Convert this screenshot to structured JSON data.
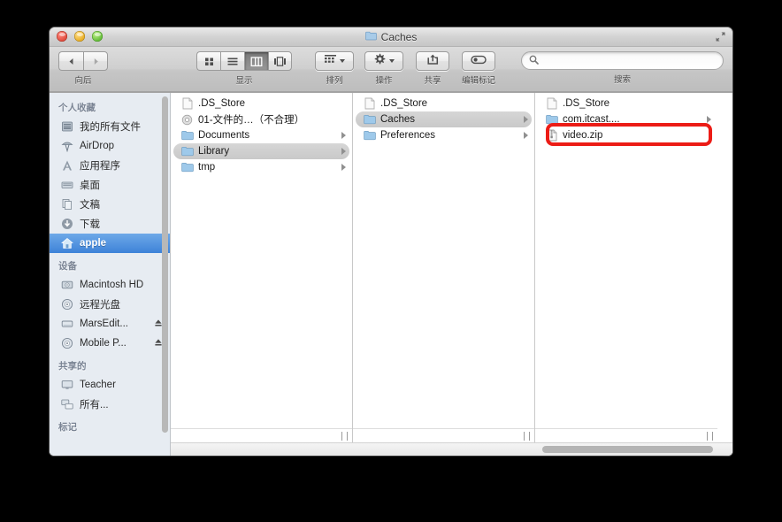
{
  "window": {
    "title": "Caches",
    "title_icon": "folder-icon",
    "traffic_lights": [
      "close-button",
      "minimize-button",
      "zoom-button"
    ],
    "fullscreen_icon": "fullscreen-arrows-icon"
  },
  "toolbar": {
    "nav": {
      "label": "向后",
      "back_icon": "arrow-left-icon",
      "forward_icon": "arrow-right-icon"
    },
    "view": {
      "label": "显示",
      "modes": [
        {
          "name": "icon-view",
          "icon": "grid-icon",
          "active": false
        },
        {
          "name": "list-view",
          "icon": "list-icon",
          "active": false
        },
        {
          "name": "column-view",
          "icon": "columns-icon",
          "active": true
        },
        {
          "name": "coverflow-view",
          "icon": "coverflow-icon",
          "active": false
        }
      ]
    },
    "arrange": {
      "label": "排列",
      "icon": "arrange-grid-icon"
    },
    "action": {
      "label": "操作",
      "icon": "gear-icon"
    },
    "share": {
      "label": "共享",
      "icon": "share-icon"
    },
    "tags": {
      "label": "编辑标记",
      "icon": "tag-icon"
    },
    "search": {
      "label": "搜索",
      "placeholder": "",
      "value": "",
      "icon": "search-icon"
    }
  },
  "sidebar": {
    "sections": [
      {
        "title": "个人收藏",
        "items": [
          {
            "label": "我的所有文件",
            "icon": "all-files-icon",
            "selected": false,
            "eject": false
          },
          {
            "label": "AirDrop",
            "icon": "airdrop-icon",
            "selected": false,
            "eject": false
          },
          {
            "label": "应用程序",
            "icon": "applications-icon",
            "selected": false,
            "eject": false
          },
          {
            "label": "桌面",
            "icon": "desktop-icon",
            "selected": false,
            "eject": false
          },
          {
            "label": "文稿",
            "icon": "documents-icon",
            "selected": false,
            "eject": false
          },
          {
            "label": "下载",
            "icon": "downloads-icon",
            "selected": false,
            "eject": false
          },
          {
            "label": "apple",
            "icon": "home-icon",
            "selected": true,
            "eject": false
          }
        ]
      },
      {
        "title": "设备",
        "items": [
          {
            "label": "Macintosh HD",
            "icon": "harddisk-icon",
            "selected": false,
            "eject": false
          },
          {
            "label": "远程光盘",
            "icon": "disc-icon",
            "selected": false,
            "eject": false
          },
          {
            "label": "MarsEdit...",
            "icon": "external-drive-icon",
            "selected": false,
            "eject": true
          },
          {
            "label": "Mobile P...",
            "icon": "disc-icon",
            "selected": false,
            "eject": true
          }
        ]
      },
      {
        "title": "共享的",
        "items": [
          {
            "label": "Teacher",
            "icon": "display-icon",
            "selected": false,
            "eject": false
          },
          {
            "label": "所有...",
            "icon": "network-icon",
            "selected": false,
            "eject": false
          }
        ]
      },
      {
        "title": "标记",
        "items": []
      }
    ]
  },
  "columns": [
    {
      "name": "column-home",
      "items": [
        {
          "label": ".DS_Store",
          "icon": "generic-file-icon",
          "selected": false,
          "disclosure": false,
          "redacted": false
        },
        {
          "label": "01-文件的…（不合理）",
          "icon": "gear-file-icon",
          "selected": false,
          "disclosure": false,
          "redacted": false
        },
        {
          "label": "Documents",
          "icon": "folder-icon",
          "selected": false,
          "disclosure": true,
          "redacted": false
        },
        {
          "label": "Library",
          "icon": "folder-icon",
          "selected": true,
          "disclosure": true,
          "redacted": false
        },
        {
          "label": "tmp",
          "icon": "folder-icon",
          "selected": false,
          "disclosure": true,
          "redacted": false
        }
      ]
    },
    {
      "name": "column-library",
      "items": [
        {
          "label": ".DS_Store",
          "icon": "generic-file-icon",
          "selected": false,
          "disclosure": false,
          "redacted": false
        },
        {
          "label": "Caches",
          "icon": "folder-icon",
          "selected": true,
          "disclosure": true,
          "redacted": false
        },
        {
          "label": "Preferences",
          "icon": "folder-icon",
          "selected": false,
          "disclosure": true,
          "redacted": false
        }
      ]
    },
    {
      "name": "column-caches",
      "items": [
        {
          "label": ".DS_Store",
          "icon": "generic-file-icon",
          "selected": false,
          "disclosure": false,
          "redacted": false
        },
        {
          "label": "com.itcast....",
          "icon": "folder-icon",
          "selected": false,
          "disclosure": true,
          "redacted": true
        },
        {
          "label": "video.zip",
          "icon": "archive-file-icon",
          "selected": false,
          "disclosure": false,
          "redacted": false
        }
      ]
    }
  ],
  "annotation": {
    "name": "red-highlight-box",
    "target": "video.zip",
    "color": "#ec1c16"
  },
  "scrollbars": {
    "sidebar_vertical": "sidebar-scrollbar",
    "horizontal": "columns-horizontal-scrollbar"
  }
}
